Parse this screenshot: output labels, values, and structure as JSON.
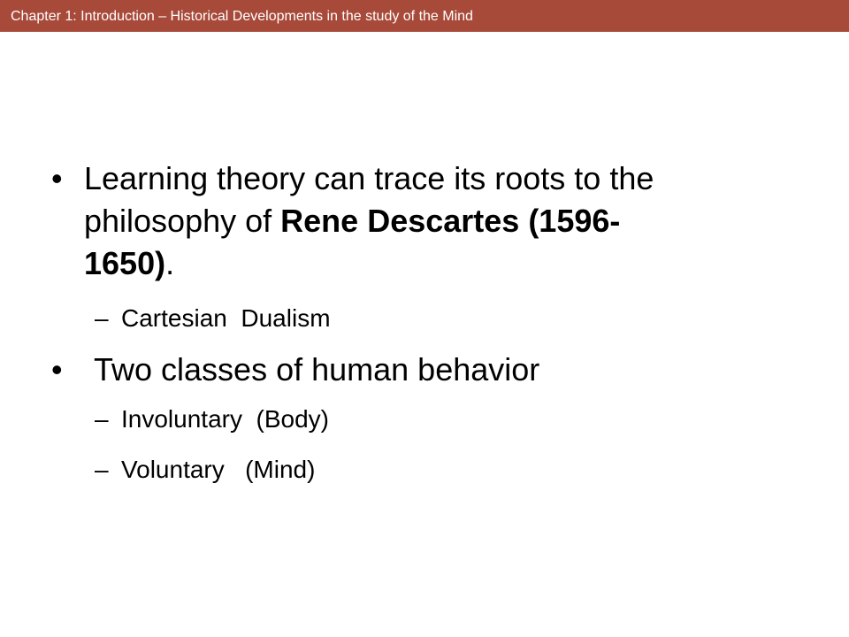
{
  "header": {
    "title": "Chapter 1: Introduction – Historical Developments in the study of the Mind"
  },
  "slide": {
    "bullet_char": "•",
    "dash_char": "–",
    "bullet1": {
      "line1": "Learning theory can trace its roots to the",
      "line2_normal": "philosophy of ",
      "line2_bold": "Rene Descartes (1596-",
      "line3_bold": "1650)",
      "line3_normal": "."
    },
    "sub1": "Cartesian  Dualism",
    "bullet2": "Two classes of human behavior",
    "sub2": "Involuntary  (Body)",
    "sub3": "Voluntary   (Mind)"
  },
  "colors": {
    "header_bg": "#a84a3a",
    "header_text": "#ffffff",
    "body_text": "#000000"
  }
}
